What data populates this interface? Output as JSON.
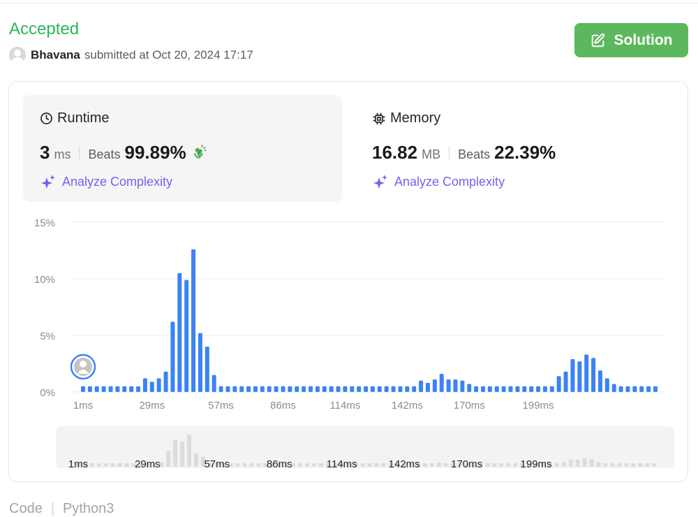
{
  "header": {
    "status": "Accepted",
    "username": "Bhavana",
    "submitted_text": "submitted at Oct 20, 2024 17:17",
    "solution_label": "Solution"
  },
  "runtime": {
    "title": "Runtime",
    "value": "3",
    "unit": "ms",
    "beats_label": "Beats",
    "beats_value": "99.89%",
    "analyze_label": "Analyze Complexity"
  },
  "memory": {
    "title": "Memory",
    "value": "16.82",
    "unit": "MB",
    "beats_label": "Beats",
    "beats_value": "22.39%",
    "analyze_label": "Analyze Complexity"
  },
  "colors": {
    "accent_green": "#2db55d",
    "button_green": "#5cb85c",
    "bar_blue": "#3b82f6",
    "analyze_purple": "#7b5df0"
  },
  "chart_data": {
    "type": "bar",
    "title": "",
    "xlabel": "",
    "ylabel": "",
    "y_ticks": [
      "15%",
      "10%",
      "5%",
      "0%"
    ],
    "x_ticks": [
      "1ms",
      "29ms",
      "57ms",
      "86ms",
      "114ms",
      "142ms",
      "170ms",
      "199ms"
    ],
    "ylim": [
      0,
      15
    ],
    "values": [
      0.5,
      0.5,
      0.5,
      0.5,
      0.5,
      0.5,
      0.5,
      0.5,
      0.5,
      1.2,
      0.9,
      1.2,
      1.8,
      6.2,
      10.5,
      9.9,
      12.6,
      5.2,
      4.0,
      1.5,
      0.5,
      0.5,
      0.5,
      0.5,
      0.5,
      0.5,
      0.5,
      0.5,
      0.5,
      0.5,
      0.5,
      0.5,
      0.5,
      0.5,
      0.5,
      0.5,
      0.5,
      0.5,
      0.5,
      0.5,
      0.5,
      0.5,
      0.5,
      0.5,
      0.5,
      0.5,
      0.5,
      0.5,
      0.5,
      1.0,
      0.8,
      1.1,
      1.6,
      1.1,
      1.1,
      1.0,
      0.7,
      0.5,
      0.5,
      0.5,
      0.5,
      0.5,
      0.5,
      0.5,
      0.5,
      0.5,
      0.5,
      0.5,
      0.5,
      1.4,
      1.8,
      2.9,
      2.7,
      3.3,
      3.0,
      1.9,
      1.2,
      0.7,
      0.5,
      0.5,
      0.5,
      0.5,
      0.5,
      0.5
    ],
    "highlight_index": 0,
    "grid": true
  }
}
